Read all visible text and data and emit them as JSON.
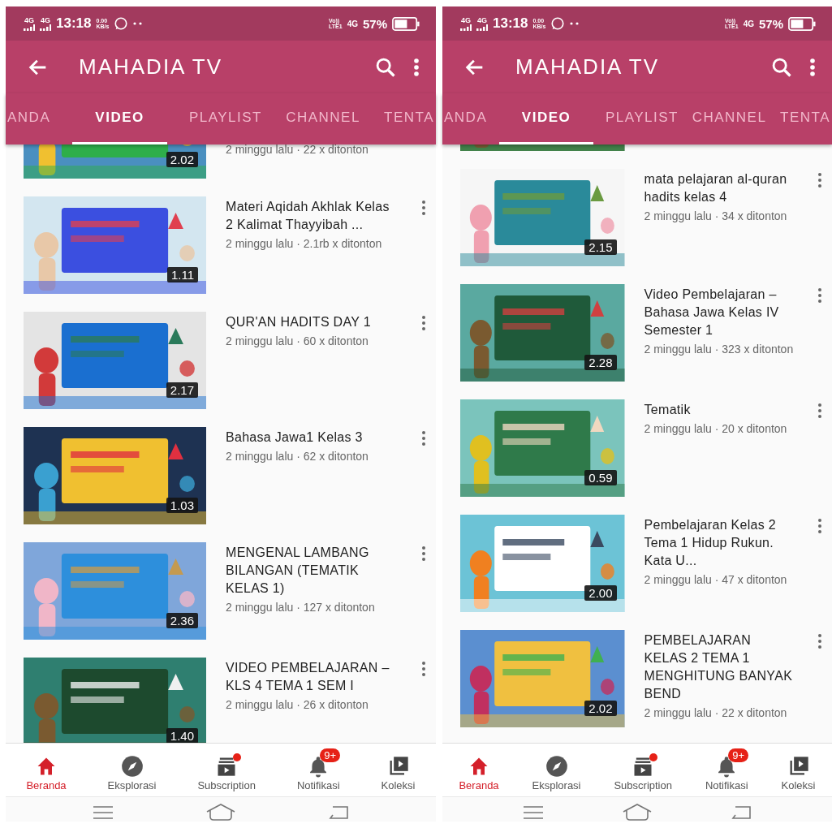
{
  "phones": [
    {
      "status_bar": {
        "sim_labels": [
          "4G",
          "4G"
        ],
        "time": "13:18",
        "net_speed": [
          "0.00",
          "KB/s"
        ],
        "volte": [
          "Vo))",
          "LTE1"
        ],
        "data_label": "4G",
        "battery": "57%"
      },
      "app_bar": {
        "title": "MAHADIA TV"
      },
      "tabs": [
        {
          "label": "ANDA",
          "selected": false
        },
        {
          "label": "VIDEO",
          "selected": true
        },
        {
          "label": "PLAYLIST",
          "selected": false
        },
        {
          "label": "CHANNEL",
          "selected": false
        },
        {
          "label": "TENTA",
          "selected": false
        }
      ],
      "videos": [
        {
          "kind": "picture",
          "duration": "2.02",
          "meta": "2 minggu lalu · 22 x ditonton"
        },
        {
          "kind": "picture",
          "title": "Materi Aqidah Akhlak Kelas 2 Kalimat Thayyibah ...",
          "meta": "2 minggu lalu · 2.1rb x ditonton",
          "duration": "1.11"
        },
        {
          "kind": "picture",
          "title": "QUR'AN HADITS DAY 1",
          "meta": "2 minggu lalu · 60 x ditonton",
          "duration": "2.17"
        },
        {
          "kind": "picture",
          "title": "Bahasa Jawa1 Kelas 3",
          "meta": "2 minggu lalu · 62 x ditonton",
          "duration": "1.03"
        },
        {
          "kind": "picture",
          "title": "MENGENAL LAMBANG BILANGAN (TEMATIK KELAS 1)",
          "meta": "2 minggu lalu · 127 x ditonton",
          "duration": "2.36"
        },
        {
          "kind": "picture",
          "title": "VIDEO PEMBELAJARAN – KLS 4 TEMA 1 SEM I",
          "meta": "2 minggu lalu · 26 x ditonton",
          "duration": "1.40"
        }
      ],
      "bottom_nav": [
        {
          "label": "Beranda",
          "kind": "home",
          "selected": true
        },
        {
          "label": "Eksplorasi",
          "kind": "explore",
          "selected": false
        },
        {
          "label": "Subscription",
          "kind": "subscription",
          "selected": false,
          "dot": true
        },
        {
          "label": "Notifikasi",
          "kind": "bell",
          "selected": false,
          "badge": "9+"
        },
        {
          "label": "Koleksi",
          "kind": "library",
          "selected": false
        }
      ]
    },
    {
      "status_bar": {
        "sim_labels": [
          "4G",
          "4G"
        ],
        "time": "13:18",
        "net_speed": [
          "0.00",
          "KB/s"
        ],
        "volte": [
          "Vo))",
          "LTE1"
        ],
        "data_label": "4G",
        "battery": "57%"
      },
      "app_bar": {
        "title": "MAHADIA TV"
      },
      "tabs": [
        {
          "label": "ANDA",
          "selected": false
        },
        {
          "label": "VIDEO",
          "selected": true
        },
        {
          "label": "PLAYLIST",
          "selected": false
        },
        {
          "label": "CHANNEL",
          "selected": false
        },
        {
          "label": "TENTA",
          "selected": false
        }
      ],
      "videos": [
        {
          "kind": "picture"
        },
        {
          "kind": "picture",
          "title": "mata pelajaran al-quran hadits kelas 4",
          "meta": "2 minggu lalu · 34 x ditonton",
          "duration": "2.15"
        },
        {
          "kind": "picture",
          "title": "Video Pembelajaran –Bahasa Jawa Kelas IV Semester 1",
          "meta": "2 minggu lalu · 323 x ditonton",
          "duration": "2.28"
        },
        {
          "kind": "picture",
          "title": "Tematik",
          "meta": "2 minggu lalu · 20 x ditonton",
          "duration": "0.59"
        },
        {
          "kind": "picture",
          "title": "Pembelajaran Kelas 2 Tema 1 Hidup Rukun. Kata U...",
          "meta": "2 minggu lalu · 47 x ditonton",
          "duration": "2.00"
        },
        {
          "kind": "picture",
          "title": "PEMBELAJARAN KELAS 2 TEMA 1 MENGHITUNG BANYAK BEND",
          "meta": "2 minggu lalu · 22 x ditonton",
          "duration": "2.02"
        }
      ],
      "bottom_nav": [
        {
          "label": "Beranda",
          "kind": "home",
          "selected": true
        },
        {
          "label": "Eksplorasi",
          "kind": "explore",
          "selected": false
        },
        {
          "label": "Subscription",
          "kind": "subscription",
          "selected": false,
          "dot": true
        },
        {
          "label": "Notifikasi",
          "kind": "bell",
          "selected": false,
          "badge": "9+"
        },
        {
          "label": "Koleksi",
          "kind": "library",
          "selected": false
        }
      ]
    }
  ]
}
